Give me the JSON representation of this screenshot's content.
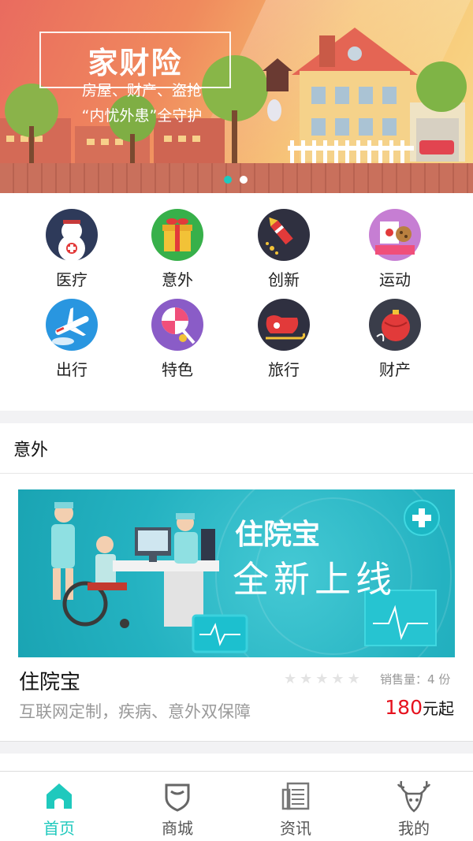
{
  "banner": {
    "title": "家财险",
    "subtitle_line1": "房屋、财产、盗抢",
    "subtitle_line2": "“内忧外患”全守护",
    "dots": [
      true,
      false
    ]
  },
  "categories": [
    {
      "label": "医疗",
      "icon": "snowman-medical-icon",
      "color": "#2e3a5a"
    },
    {
      "label": "意外",
      "icon": "gift-box-icon",
      "color": "#37b04a"
    },
    {
      "label": "创新",
      "icon": "firework-rocket-icon",
      "color": "#2f3040"
    },
    {
      "label": "运动",
      "icon": "cookie-box-icon",
      "color": "#c67ed3"
    },
    {
      "label": "出行",
      "icon": "airplane-icon",
      "color": "#2996e0"
    },
    {
      "label": "特色",
      "icon": "lollipop-icon",
      "color": "#8a5cc7"
    },
    {
      "label": "旅行",
      "icon": "sleigh-icon",
      "color": "#2f3040"
    },
    {
      "label": "财产",
      "icon": "ornament-ball-icon",
      "color": "#3a3d4a"
    }
  ],
  "section": {
    "title": "意外"
  },
  "product": {
    "image_title": "住院宝",
    "image_subtitle": "全新上线",
    "name": "住院宝",
    "rating": 0,
    "sales_label": "销售量：",
    "sales_value": "4 份",
    "description": "互联网定制，疾病、意外双保障",
    "price_value": "180",
    "price_suffix": "元起"
  },
  "tabs": [
    {
      "label": "首页",
      "icon": "home-icon",
      "active": true
    },
    {
      "label": "商城",
      "icon": "shield-icon",
      "active": false
    },
    {
      "label": "资讯",
      "icon": "newspaper-icon",
      "active": false
    },
    {
      "label": "我的",
      "icon": "deer-icon",
      "active": false
    }
  ],
  "colors": {
    "accent": "#1fc9bd",
    "price": "#e6121e"
  }
}
